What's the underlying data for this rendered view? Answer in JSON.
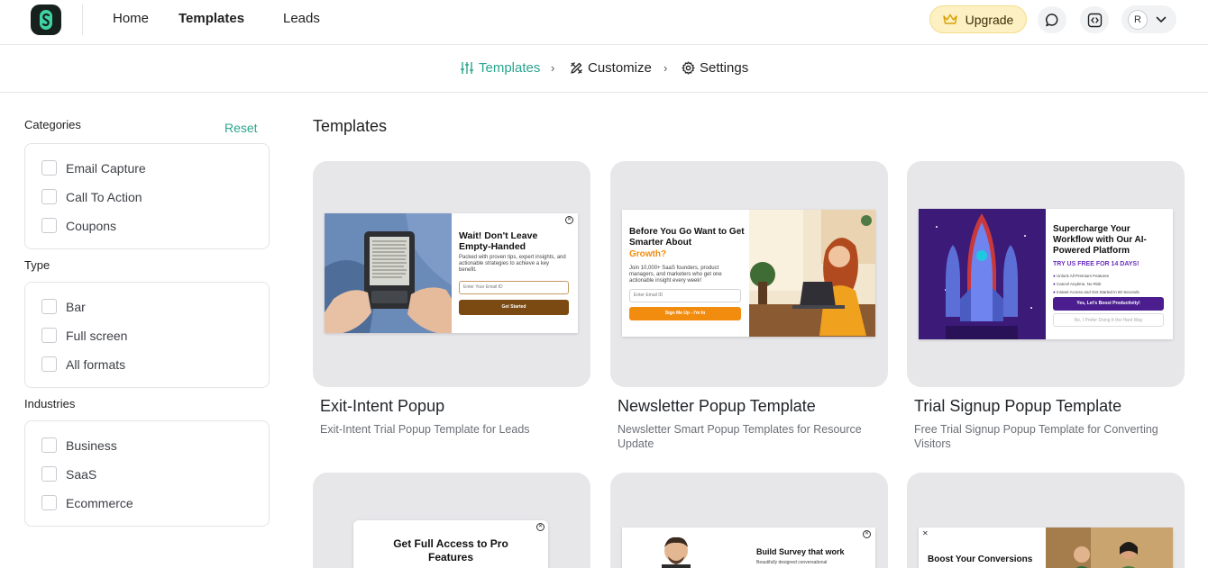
{
  "nav": {
    "links": [
      "Home",
      "Templates",
      "Leads"
    ],
    "upgrade_label": "Upgrade",
    "user_initial": "R"
  },
  "steps": [
    "Templates",
    "Customize",
    "Settings"
  ],
  "sidebar": {
    "reset_label": "Reset",
    "groups": [
      {
        "title": "Categories",
        "items": [
          "Email Capture",
          "Call To Action",
          "Coupons"
        ]
      },
      {
        "title": "Type",
        "items": [
          "Bar",
          "Full screen",
          "All formats"
        ]
      },
      {
        "title": "Industries",
        "items": [
          "Business",
          "SaaS",
          "Ecommerce"
        ]
      }
    ]
  },
  "main": {
    "title": "Templates",
    "cards": [
      {
        "title": "Exit-Intent Popup",
        "description": "Exit-Intent Trial Popup Template for Leads",
        "preview": {
          "heading": "Wait! Don't Leave Empty-Handed",
          "text": "Packed with proven tips, expert insights, and actionable strategies to achieve a key benefit.",
          "input_placeholder": "Enter Your Email ID",
          "button": "Get Started"
        }
      },
      {
        "title": "Newsletter Popup Template",
        "description": "Newsletter Smart Popup Templates for Resource Update",
        "preview": {
          "heading": "Before You Go Want to Get Smarter About",
          "highlight": "Growth?",
          "text": "Join 10,000+ SaaS founders, product managers, and marketers who get one actionable insight every week!",
          "input_placeholder": "Enter Email ID",
          "button": "Sign Me Up - I'm In"
        }
      },
      {
        "title": "Trial Signup Popup Template",
        "description": "Free Trial Signup Popup Template for Converting Visitors",
        "preview": {
          "heading": "Supercharge Your Workflow with Our AI-Powered Platform",
          "subheading": "TRY US FREE FOR 14 DAYS!",
          "bullets": [
            "Unlock All Premium Features",
            "Cancel Anytime, No Risk",
            "Instant Access and Get Started in 60 Seconds"
          ],
          "button": "Yes, Let's Boost Productivity!",
          "decline": "No, I Prefer Doing It the Hard Way"
        }
      },
      {
        "preview": {
          "heading": "Get Full Access to Pro Features"
        }
      },
      {
        "preview": {
          "heading": "Build Survey that work",
          "text": "Beautifully designed conversational"
        }
      },
      {
        "preview": {
          "heading": "Boost Your Conversions"
        }
      }
    ]
  },
  "colors": {
    "accent": "#2aa58e",
    "upgrade_bg": "#fdf0c2",
    "brown_button": "#7a4a12",
    "orange_button": "#f28c0f",
    "purple_button": "#4b1d8f"
  }
}
